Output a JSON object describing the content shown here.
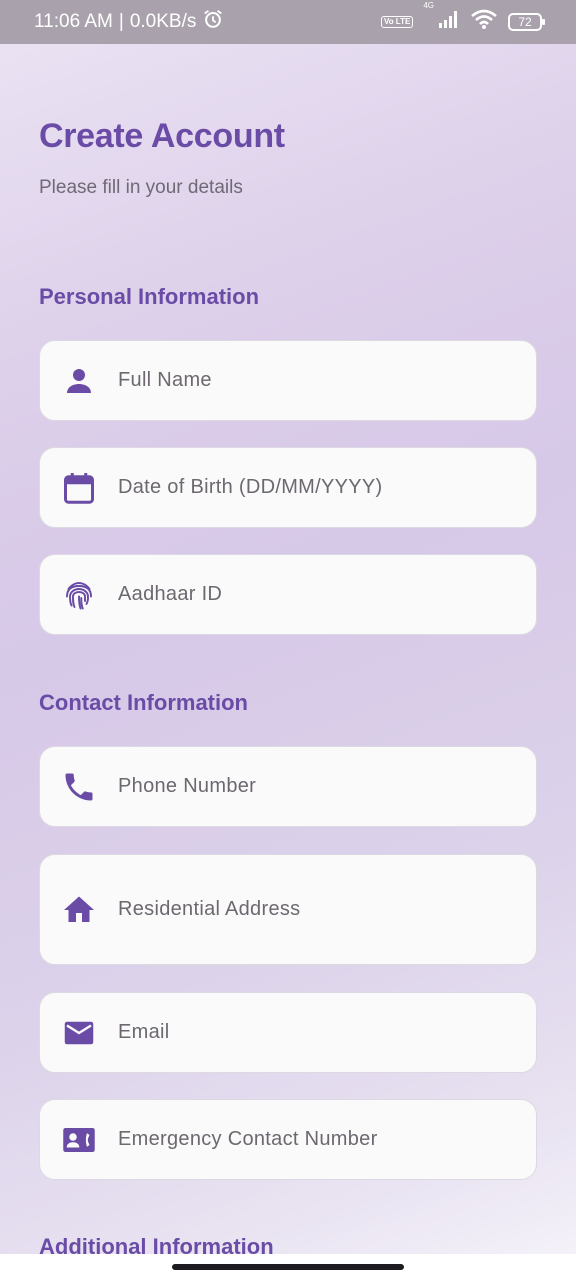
{
  "status_bar": {
    "time": "11:06 AM",
    "speed": "0.0KB/s",
    "volte": "Vo LTE",
    "network": "4G",
    "battery": "72"
  },
  "header": {
    "title": "Create Account",
    "subtitle": "Please fill in your details"
  },
  "sections": {
    "personal": "Personal Information",
    "contact": "Contact Information",
    "additional": "Additional Information"
  },
  "fields": {
    "full_name": {
      "placeholder": "Full Name",
      "icon": "person-icon"
    },
    "dob": {
      "placeholder": "Date of Birth (DD/MM/YYYY)",
      "icon": "calendar-icon"
    },
    "aadhaar": {
      "placeholder": "Aadhaar ID",
      "icon": "fingerprint-icon"
    },
    "phone": {
      "placeholder": "Phone Number",
      "icon": "phone-icon"
    },
    "address": {
      "placeholder": "Residential Address",
      "icon": "home-icon"
    },
    "email": {
      "placeholder": "Email",
      "icon": "mail-icon"
    },
    "emergency": {
      "placeholder": "Emergency Contact Number",
      "icon": "contact-phone-icon"
    }
  },
  "colors": {
    "accent": "#6a4ca7",
    "field_bg": "#fafafa",
    "status_bar": "#a9a2ad"
  }
}
